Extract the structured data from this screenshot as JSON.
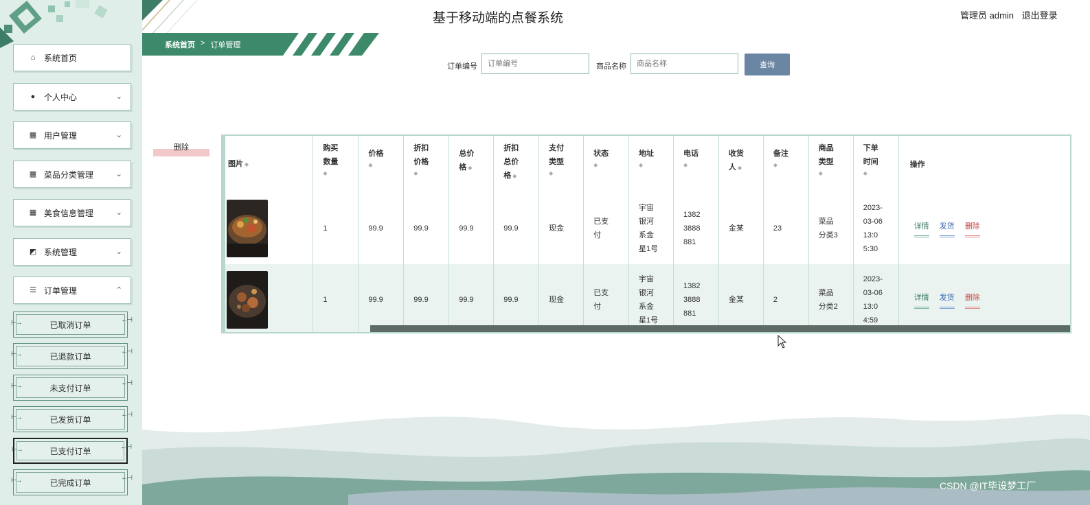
{
  "header": {
    "title": "基于移动端的点餐系统",
    "user_label": "管理员 admin",
    "logout_label": "退出登录"
  },
  "breadcrumb": {
    "home": "系统首页",
    "separator": ">",
    "current": "订单管理"
  },
  "sidebar": {
    "items": [
      {
        "label": "系统首页",
        "icon": "home-icon"
      },
      {
        "label": "个人中心",
        "icon": "user-icon"
      },
      {
        "label": "用户管理",
        "icon": "grid-icon"
      },
      {
        "label": "菜品分类管理",
        "icon": "grid-icon"
      },
      {
        "label": "美食信息管理",
        "icon": "grid-icon"
      },
      {
        "label": "系统管理",
        "icon": "chart-icon"
      },
      {
        "label": "订单管理",
        "icon": "list-icon"
      }
    ],
    "sub_items": [
      {
        "label": "已取消订单"
      },
      {
        "label": "已退款订单"
      },
      {
        "label": "未支付订单"
      },
      {
        "label": "已发货订单"
      },
      {
        "label": "已支付订单"
      },
      {
        "label": "已完成订单"
      }
    ]
  },
  "search": {
    "order_no_label": "订单编号",
    "order_no_placeholder": "订单编号",
    "product_name_label": "商品名称",
    "product_name_placeholder": "商品名称",
    "query_button": "查询"
  },
  "actions": {
    "delete_button": "删除"
  },
  "table": {
    "headers": [
      {
        "line1": "图片",
        "line2": ""
      },
      {
        "line1": "购买",
        "line2": "数量"
      },
      {
        "line1": "价格",
        "line2": ""
      },
      {
        "line1": "折扣",
        "line2": "价格"
      },
      {
        "line1": "总价",
        "line2": "格"
      },
      {
        "line1": "折扣",
        "line2": "总价",
        "line3": "格"
      },
      {
        "line1": "支付",
        "line2": "类型"
      },
      {
        "line1": "状态",
        "line2": ""
      },
      {
        "line1": "地址",
        "line2": ""
      },
      {
        "line1": "电话",
        "line2": ""
      },
      {
        "line1": "收货",
        "line2": "人"
      },
      {
        "line1": "备注",
        "line2": ""
      },
      {
        "line1": "商品",
        "line2": "类型"
      },
      {
        "line1": "下单",
        "line2": "时间"
      },
      {
        "line1": "操作",
        "line2": ""
      }
    ],
    "rows": [
      {
        "quantity": "1",
        "price": "99.9",
        "discount_price": "99.9",
        "total": "99.9",
        "discount_total": "99.9",
        "pay_type": "现金",
        "status_1": "已支",
        "status_2": "付",
        "addr_1": "宇宙",
        "addr_2": "银河",
        "addr_3": "系金",
        "addr_4": "星1号",
        "phone_1": "1382",
        "phone_2": "3888",
        "phone_3": "881",
        "receiver": "金某",
        "remark": "23",
        "type_1": "菜品",
        "type_2": "分类3",
        "time_1": "2023-",
        "time_2": "03-06",
        "time_3": "13:0",
        "time_4": "5:30"
      },
      {
        "quantity": "1",
        "price": "99.9",
        "discount_price": "99.9",
        "total": "99.9",
        "discount_total": "99.9",
        "pay_type": "现金",
        "status_1": "已支",
        "status_2": "付",
        "addr_1": "宇宙",
        "addr_2": "银河",
        "addr_3": "系金",
        "addr_4": "星1号",
        "phone_1": "1382",
        "phone_2": "3888",
        "phone_3": "881",
        "receiver": "金某",
        "remark": "2",
        "type_1": "菜品",
        "type_2": "分类2",
        "time_1": "2023-",
        "time_2": "03-06",
        "time_3": "13:0",
        "time_4": "4:59"
      }
    ],
    "ops": {
      "detail": "详情",
      "ship": "发货",
      "delete": "删除"
    }
  },
  "watermark": "CSDN @IT毕设梦工厂",
  "colors": {
    "sidebar_bg": "#dfeee9",
    "accent_green": "#3d8a6a",
    "query_button": "#6b86a3",
    "table_border": "#b7d7cc"
  }
}
